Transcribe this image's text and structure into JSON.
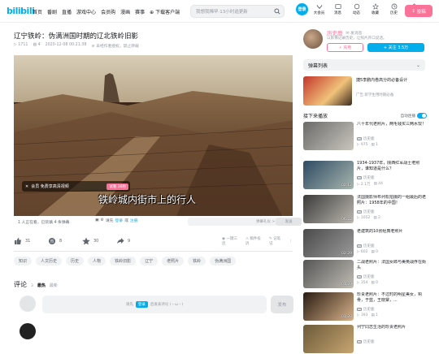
{
  "header": {
    "logo": "bilibili",
    "nav": [
      "首页",
      "番剧",
      "直播",
      "游戏中心",
      "会员购",
      "漫画",
      "赛事",
      "下载客户端"
    ],
    "search_placeholder": "我想我稀罕·13小时追更新",
    "user_initial": "登录",
    "icons": [
      {
        "name": "vip-icon",
        "label": "大会员"
      },
      {
        "name": "message-icon",
        "label": "消息"
      },
      {
        "name": "dynamic-icon",
        "label": "动态"
      },
      {
        "name": "favorite-icon",
        "label": "收藏"
      },
      {
        "name": "history-icon",
        "label": "历史"
      },
      {
        "name": "creator-icon",
        "label": "创作中心"
      }
    ],
    "upload_label": "投稿"
  },
  "video": {
    "title": "辽宁铁岭：伪满洲国时期的辽北铁岭旧影",
    "views": "1711",
    "danmaku": "4",
    "date": "2020-12-08 00:21:38",
    "notice": "未经作者授权，禁止转载",
    "ad_label": "会员 免费享高清视频",
    "ad_button": "试看 30秒",
    "subtitle": "铁岭城内街市上的行人"
  },
  "danmaku_bar": {
    "watching": "1 人正在看，已装填 4 条弹幕",
    "input_prefix": "请先",
    "login": "登录",
    "input_suffix": "或",
    "register": "注册",
    "pref": "弹幕礼仪 >",
    "send": "发送"
  },
  "actions": {
    "like": "31",
    "coin": "8",
    "favorite": "30",
    "share": "9",
    "right": [
      "一键三连",
      "稿件投诉",
      "记笔记"
    ]
  },
  "tags": [
    "知识",
    "人文历史",
    "历史",
    "人物",
    "铁岭旧影",
    "辽宁",
    "老照片",
    "铁岭",
    "伪满洲国"
  ],
  "comments": {
    "heading": "评论",
    "count": "3",
    "sort_hot": "最热",
    "sort_new": "最新",
    "box_prefix": "请先",
    "box_login": "登录",
    "box_suffix": "后发表评论 (・ω・)",
    "send": "发布"
  },
  "up": {
    "name": "历史鹿",
    "msg": "发消息",
    "desc": "以影像记录历史，让照片开口说话。",
    "charge": "充电",
    "follow": "+ 关注 3.5万"
  },
  "sidebar": {
    "danmaku_list": "弹幕列表",
    "promo_title": "捷5李鹏内卷高分的必备设计",
    "promo_ad": "广告 新学生用时期必备",
    "next_heading": "接下来播放",
    "autoplay": "自动连播",
    "recommendations": [
      {
        "title": "八十年代老照片，两毛钱买三两水饺！",
        "up": "历史鹿",
        "views": "975",
        "comments": "1",
        "duration": "",
        "colors": [
          "#6a6a6a",
          "#c9c6bd"
        ]
      },
      {
        "title": "1934-1937年，陕西红军战士老照片，谁知道是什么？",
        "up": "历史鹿",
        "views": "2.1万",
        "comments": "44",
        "duration": "02:12",
        "colors": [
          "#2e4b63",
          "#a7b5ad"
        ]
      },
      {
        "title": "法国摄影师布列松拍摄的一组最后的老照片：1958年的中国！",
        "up": "历史鹿",
        "views": "1052",
        "comments": "2",
        "duration": "06:22",
        "colors": [
          "#3a3a3a",
          "#bcb8b0"
        ]
      },
      {
        "title": "老建筑的10张经典老照片",
        "up": "历史鹿",
        "views": "602",
        "comments": "0",
        "duration": "02:29",
        "colors": [
          "#4a4a4a",
          "#9a9a9a"
        ]
      },
      {
        "title": "二战老照片：法国女郎与美英战俘在街头",
        "up": "历史鹿",
        "views": "354",
        "comments": "0",
        "duration": "01:29",
        "colors": [
          "#555",
          "#c0bcb4"
        ]
      },
      {
        "title": "珍贵老照片：不过时的明星美女，钩骨，于蓝，王晓棠，...",
        "up": "历史鹿",
        "views": "393",
        "comments": "1",
        "duration": "01:28",
        "colors": [
          "#2a1c12",
          "#d8b28b"
        ]
      },
      {
        "title": "列宁同志生活的珍贵老照片",
        "up": "历史鹿",
        "views": "",
        "comments": "",
        "duration": "",
        "colors": [
          "#6b5a3a",
          "#c8a571"
        ]
      }
    ]
  },
  "colors": {
    "accent": "#00aeec",
    "pink": "#fb7299",
    "muted": "#9499a0"
  }
}
